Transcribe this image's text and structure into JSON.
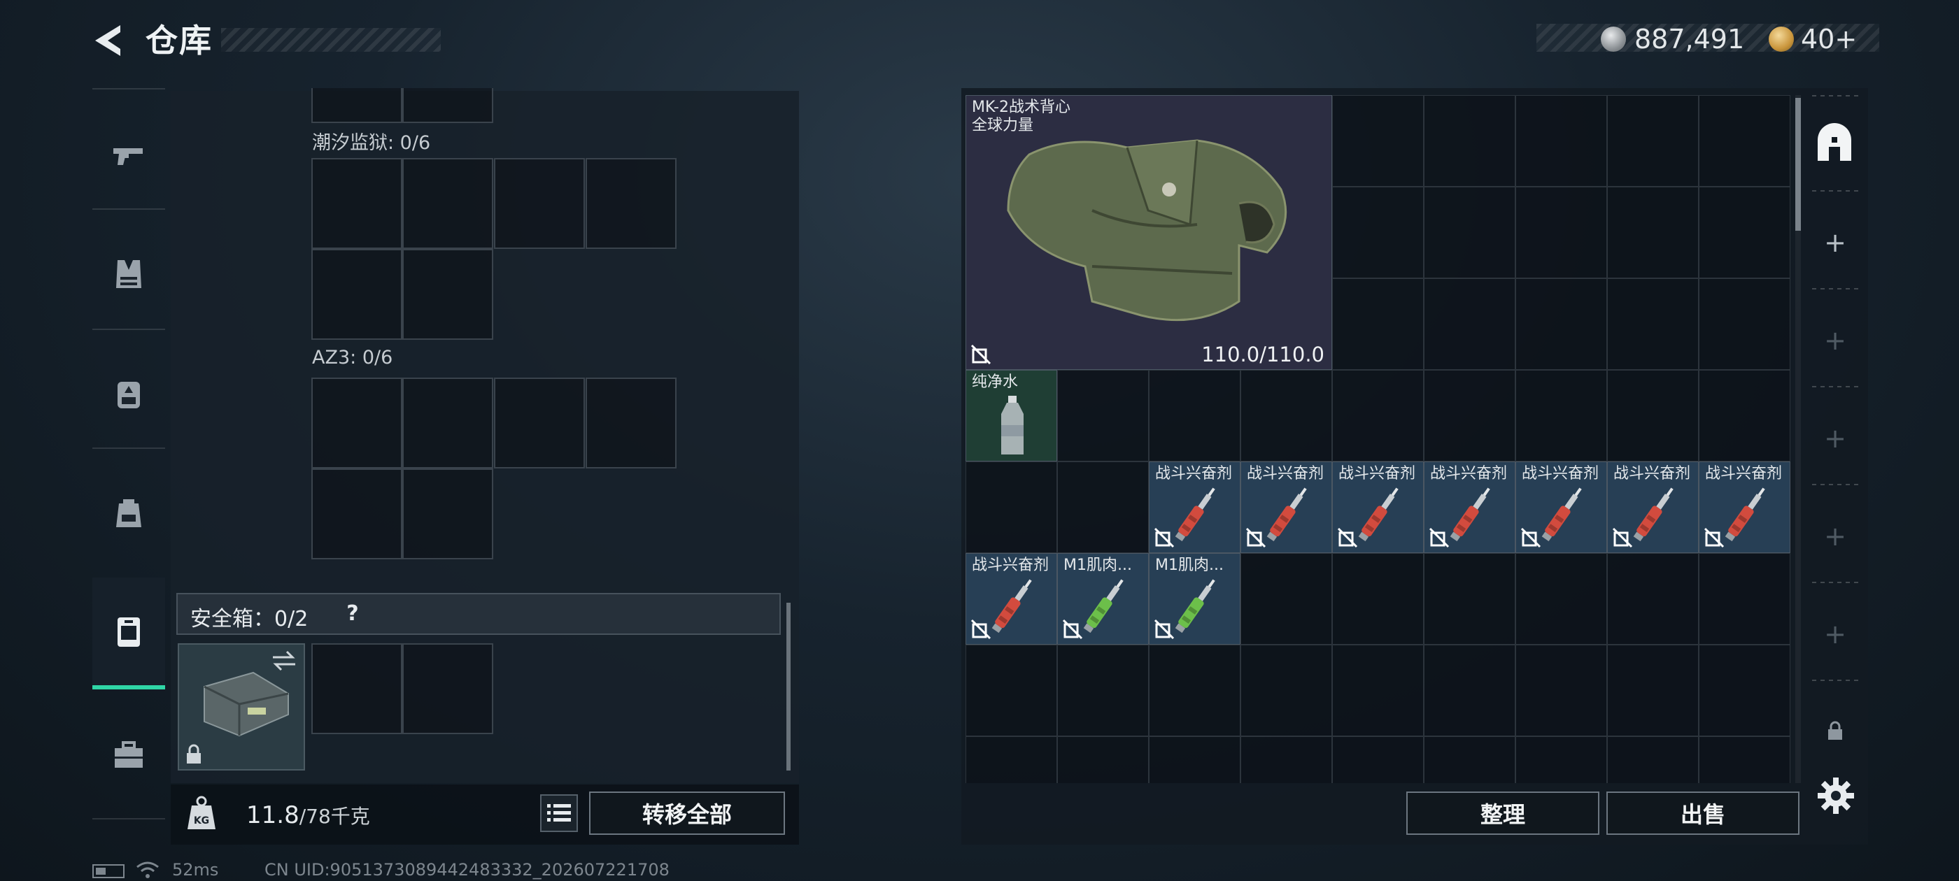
{
  "header": {
    "title": "仓库",
    "silver_amount": "887,491",
    "gold_amount": "40+"
  },
  "left_rail": {
    "items": [
      {
        "name": "weapons",
        "icon": "pistol-icon"
      },
      {
        "name": "armor",
        "icon": "vest-icon"
      },
      {
        "name": "rig",
        "icon": "rig-icon"
      },
      {
        "name": "backpack",
        "icon": "backpack-icon"
      },
      {
        "name": "safe-box",
        "icon": "safe-box-icon",
        "active": true
      },
      {
        "name": "toolbox",
        "icon": "toolbox-icon"
      }
    ]
  },
  "left_panel": {
    "grids": [
      {
        "label": "潮汐监狱: 0/6"
      },
      {
        "label": "AZ3: 0/6"
      }
    ],
    "safe_box": {
      "label": "安全箱：0/2",
      "help": "?"
    },
    "weight": {
      "current": "11.8",
      "max": "/78千克"
    },
    "transfer_all_label": "转移全部"
  },
  "stash": {
    "items": [
      {
        "name": "vest",
        "label_line1": "MK-2战术背心",
        "label_line2": "全球力量",
        "durability": "110.0/110.0"
      },
      {
        "name": "water",
        "label": "纯净水"
      },
      {
        "name": "stim",
        "label": "战斗兴奋剂",
        "count": 8
      },
      {
        "name": "muscle",
        "label": "M1肌肉...",
        "count": 2
      }
    ],
    "sort_label": "整理",
    "sell_label": "出售"
  },
  "status": {
    "ping": "52ms",
    "uid": "CN UID:9051373089442483332_202607221708"
  },
  "colors": {
    "accent": "#2fd6a6",
    "stim_bg": "#273f55",
    "vest_bg": "#2c2d42",
    "water_bg": "#1f3e34"
  }
}
